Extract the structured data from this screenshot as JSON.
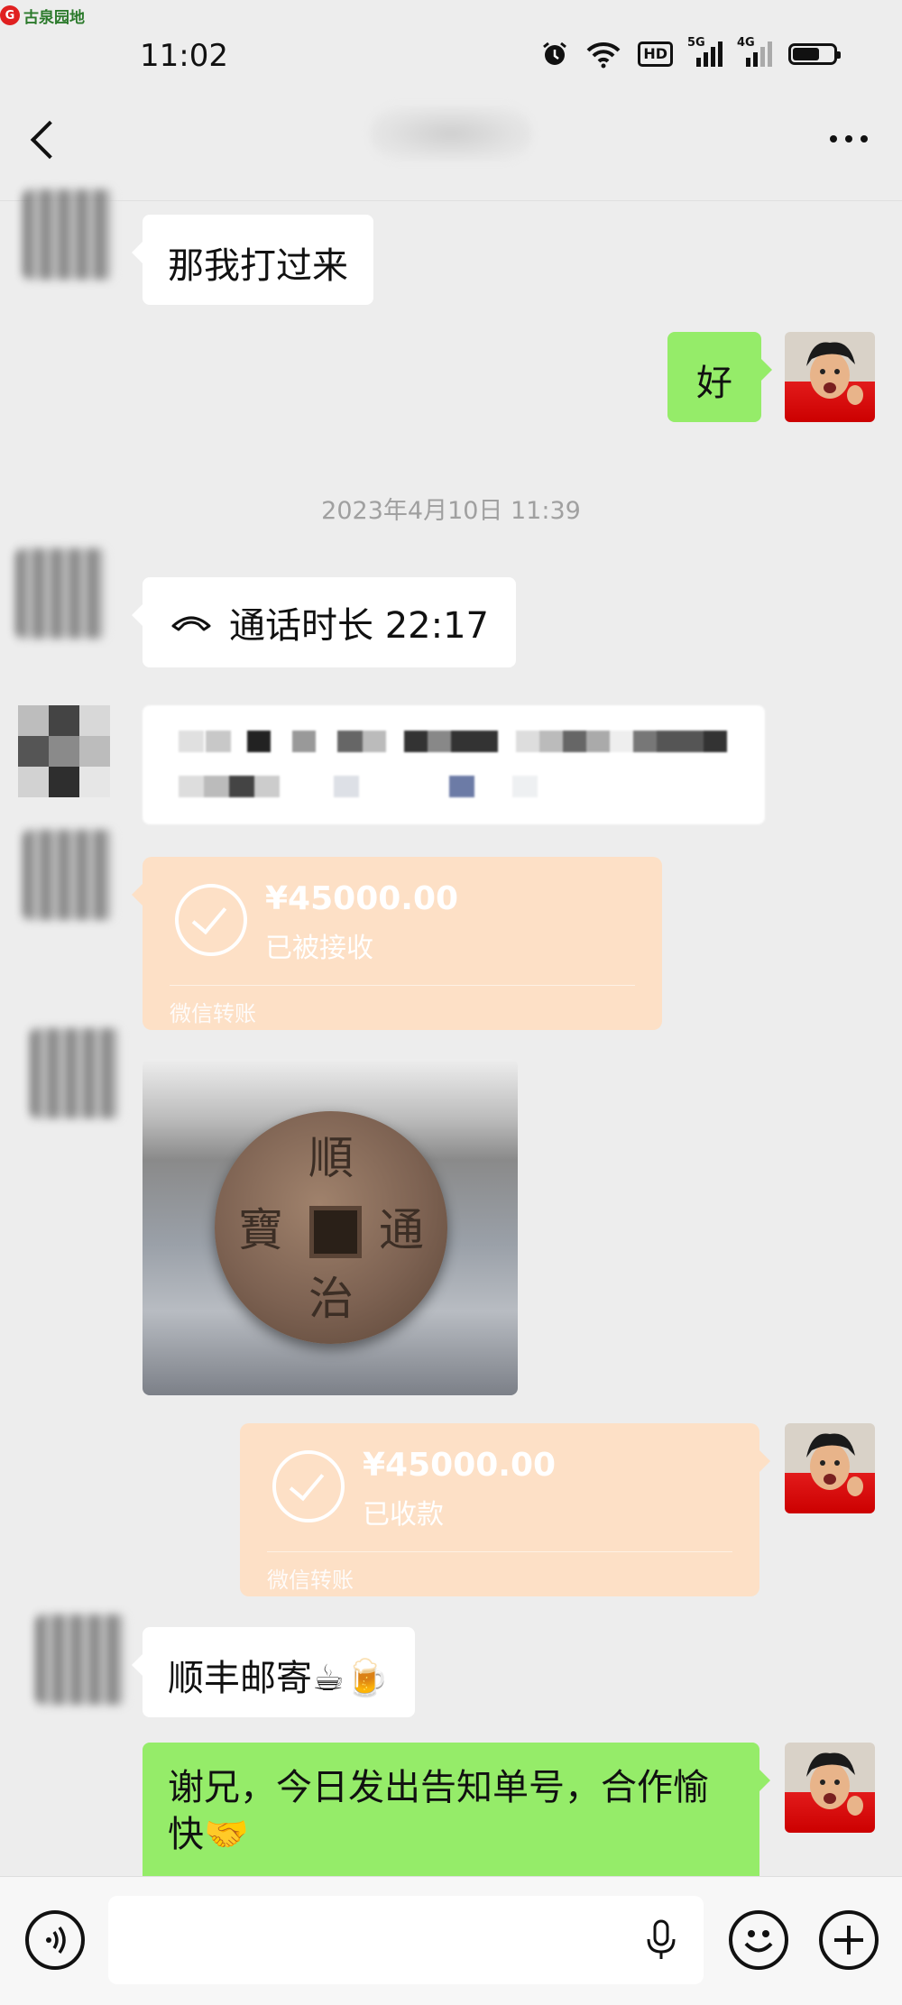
{
  "status_bar": {
    "watermark": "古泉园地",
    "time": "11:02",
    "sig1": "5G",
    "sig2": "4G",
    "hd": "HD"
  },
  "header": {
    "title": ""
  },
  "messages": {
    "m1": "那我打过来",
    "m2": "好",
    "timestamp": "2023年4月10日 11:39",
    "call_label": "通话时长 22:17",
    "transfer1": {
      "amount": "¥45000.00",
      "status": "已被接收",
      "footer": "微信转账"
    },
    "transfer2": {
      "amount": "¥45000.00",
      "status": "已收款",
      "footer": "微信转账"
    },
    "coin_chars": [
      "順",
      "治",
      "通",
      "寶"
    ],
    "m_ship": "顺丰邮寄☕🍺",
    "m_last": "谢兄，今日发出告知单号，合作愉快🤝"
  },
  "input": {
    "placeholder": ""
  },
  "colors": {
    "background": "#ededed",
    "green_bubble": "#95ec69",
    "transfer": "#fde0c6",
    "bubble_white": "#ffffff"
  },
  "icons": [
    "back-arrow-icon",
    "more-icon",
    "alarm-icon",
    "wifi-icon",
    "battery-icon",
    "phone-icon",
    "voice-icon",
    "mic-icon",
    "emoji-icon",
    "add-icon"
  ]
}
